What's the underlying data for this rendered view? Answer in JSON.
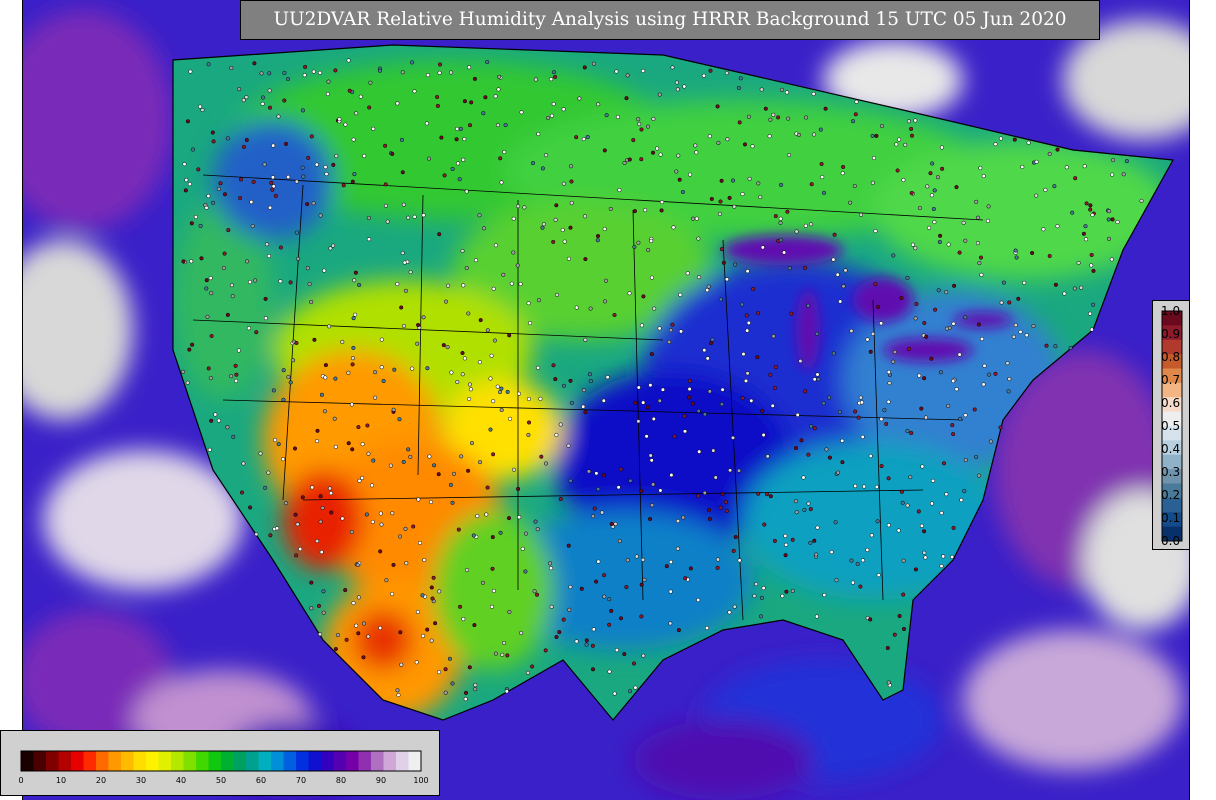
{
  "title": "UU2DVAR Relative Humidity Analysis using HRRR Background 15 UTC 05 Jun 2020",
  "obs_colorbar": {
    "ticks": [
      "1.0",
      "0.9",
      "0.8",
      "0.7",
      "0.6",
      "0.5",
      "0.4",
      "0.3",
      "0.2",
      "0.1",
      "0.0"
    ],
    "colors": [
      "#6b0a1e",
      "#8e1a2b",
      "#b13a2e",
      "#c65a2a",
      "#e0884a",
      "#f2b583",
      "#f8dccb",
      "#eeeeee",
      "#d6e2ec",
      "#b8cfe0",
      "#90b2c9",
      "#6f93ad",
      "#4a7a99",
      "#2a6093",
      "#144b8a",
      "#08306b"
    ]
  },
  "rh_colorbar": {
    "ticks": [
      "0",
      "10",
      "20",
      "30",
      "40",
      "50",
      "60",
      "70",
      "80",
      "90",
      "100"
    ],
    "colors": [
      "#1a0000",
      "#4a0000",
      "#800000",
      "#b30000",
      "#e60000",
      "#ff2a00",
      "#ff6a00",
      "#ff9900",
      "#ffbb00",
      "#ffdd00",
      "#fff200",
      "#e0f000",
      "#b5e800",
      "#80e000",
      "#40d800",
      "#10c810",
      "#00b030",
      "#00a060",
      "#00a090",
      "#00b0c0",
      "#0090d8",
      "#0060e0",
      "#0030e0",
      "#1010d0",
      "#3300c0",
      "#5500b0",
      "#7300a8",
      "#9030b0",
      "#b070c0",
      "#d0a8d8",
      "#e0d0e8",
      "#efefef"
    ]
  }
}
